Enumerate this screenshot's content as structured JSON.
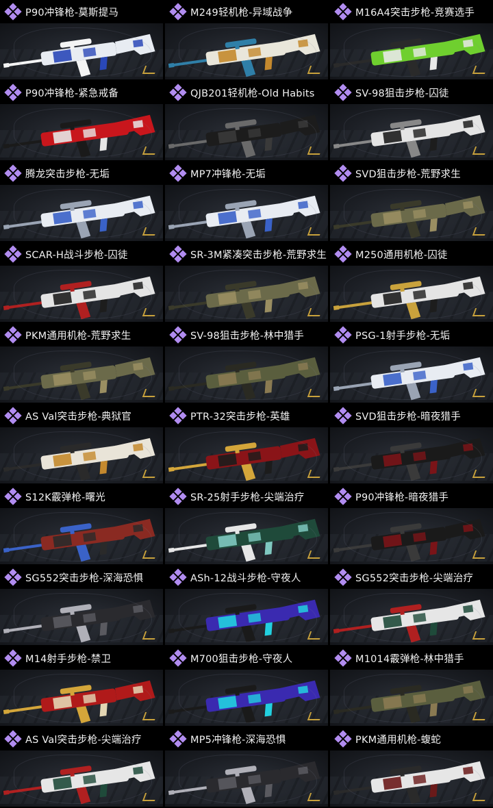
{
  "items": [
    {
      "title": "P90冲锋枪-莫斯提马",
      "primary": "#e8ecf2",
      "secondary": "#2a48b8",
      "accent": "#f4f4f4"
    },
    {
      "title": "M249轻机枪-异域战争",
      "primary": "#e9e6da",
      "secondary": "#c4892e",
      "accent": "#2f7fa8"
    },
    {
      "title": "M16A4突击步枪-竞赛选手",
      "primary": "#6fcf2f",
      "secondary": "#e8e8e8",
      "accent": "#2a2a2a"
    },
    {
      "title": "P90冲锋枪-紧急戒备",
      "primary": "#c8161c",
      "secondary": "#e6e6e6",
      "accent": "#1a1a1a"
    },
    {
      "title": "QJB201轻机枪-Old Habits",
      "primary": "#1c1c1c",
      "secondary": "#3a3a3a",
      "accent": "#6a6a6a"
    },
    {
      "title": "SV-98狙击步枪-囚徒",
      "primary": "#e4e4e4",
      "secondary": "#1d1d1d",
      "accent": "#888888"
    },
    {
      "title": "腾龙突击步枪-无垢",
      "primary": "#e8ecf2",
      "secondary": "#3a62c8",
      "accent": "#9aa4b4"
    },
    {
      "title": "MP7冲锋枪-无垢",
      "primary": "#e8ecf2",
      "secondary": "#3a62c8",
      "accent": "#9aa4b4"
    },
    {
      "title": "SVD狙击步枪-荒野求生",
      "primary": "#6b6a4a",
      "secondary": "#9a8e62",
      "accent": "#3a3a2a"
    },
    {
      "title": "SCAR-H战斗步枪-囚徒",
      "primary": "#e4e4e4",
      "secondary": "#1d1d1d",
      "accent": "#b02020"
    },
    {
      "title": "SR-3M紧凑突击步枪-荒野求生",
      "primary": "#6b6a4a",
      "secondary": "#9a8e62",
      "accent": "#3a3a2a"
    },
    {
      "title": "M250通用机枪-囚徒",
      "primary": "#e4e4e4",
      "secondary": "#1d1d1d",
      "accent": "#c9a23c"
    },
    {
      "title": "PKM通用机枪-荒野求生",
      "primary": "#6b6a4a",
      "secondary": "#9a8e62",
      "accent": "#3a3a2a"
    },
    {
      "title": "SV-98狙击步枪-林中猎手",
      "primary": "#5a5e3e",
      "secondary": "#8a7a52",
      "accent": "#2a2a22"
    },
    {
      "title": "PSG-1射手步枪-无垢",
      "primary": "#e8ecf2",
      "secondary": "#3a62c8",
      "accent": "#9aa4b4"
    },
    {
      "title": "AS Val突击步枪-典狱官",
      "primary": "#e9e4d8",
      "secondary": "#c4892e",
      "accent": "#2a2a2a"
    },
    {
      "title": "PTR-32突击步枪-英雄",
      "primary": "#8a1418",
      "secondary": "#1c1c1c",
      "accent": "#d4a63a"
    },
    {
      "title": "SVD狙击步枪-暗夜猎手",
      "primary": "#1a1a1a",
      "secondary": "#7a1418",
      "accent": "#3a3a3a"
    },
    {
      "title": "S12K霰弹枪-曙光",
      "primary": "#8a2a22",
      "secondary": "#2a2a2a",
      "accent": "#3a62c8"
    },
    {
      "title": "SR-25射手步枪-尖端治疗",
      "primary": "#1f4a3a",
      "secondary": "#7fc8c0",
      "accent": "#e6e6e6"
    },
    {
      "title": "P90冲锋枪-暗夜猎手",
      "primary": "#1a1a1a",
      "secondary": "#7a1418",
      "accent": "#3a3a3a"
    },
    {
      "title": "SG552突击步枪-深海恐惧",
      "primary": "#2a2a2e",
      "secondary": "#5a5a60",
      "accent": "#b0b0b8"
    },
    {
      "title": "ASh-12战斗步枪-守夜人",
      "primary": "#3a2ab0",
      "secondary": "#22d0e0",
      "accent": "#1a1a1a"
    },
    {
      "title": "SG552突击步枪-尖端治疗",
      "primary": "#e6e6e6",
      "secondary": "#1f4a3a",
      "accent": "#b02020"
    },
    {
      "title": "M14射手步枪-禁卫",
      "primary": "#b01a1a",
      "secondary": "#e4d6b4",
      "accent": "#d4a63a"
    },
    {
      "title": "M700狙击步枪-守夜人",
      "primary": "#3a2ab0",
      "secondary": "#22d0e0",
      "accent": "#1a1a1a"
    },
    {
      "title": "M1014霰弹枪-林中猎手",
      "primary": "#5a5e3e",
      "secondary": "#8a7a52",
      "accent": "#2a2a22"
    },
    {
      "title": "AS Val突击步枪-尖端治疗",
      "primary": "#e6e6e6",
      "secondary": "#1f4a3a",
      "accent": "#b02020"
    },
    {
      "title": "MP5冲锋枪-深海恐惧",
      "primary": "#2a2a2e",
      "secondary": "#5a5a60",
      "accent": "#b0b0b8"
    },
    {
      "title": "PKM通用机枪-蝮蛇",
      "primary": "#e6e6e6",
      "secondary": "#6a1a1a",
      "accent": "#2a2a2a"
    }
  ]
}
